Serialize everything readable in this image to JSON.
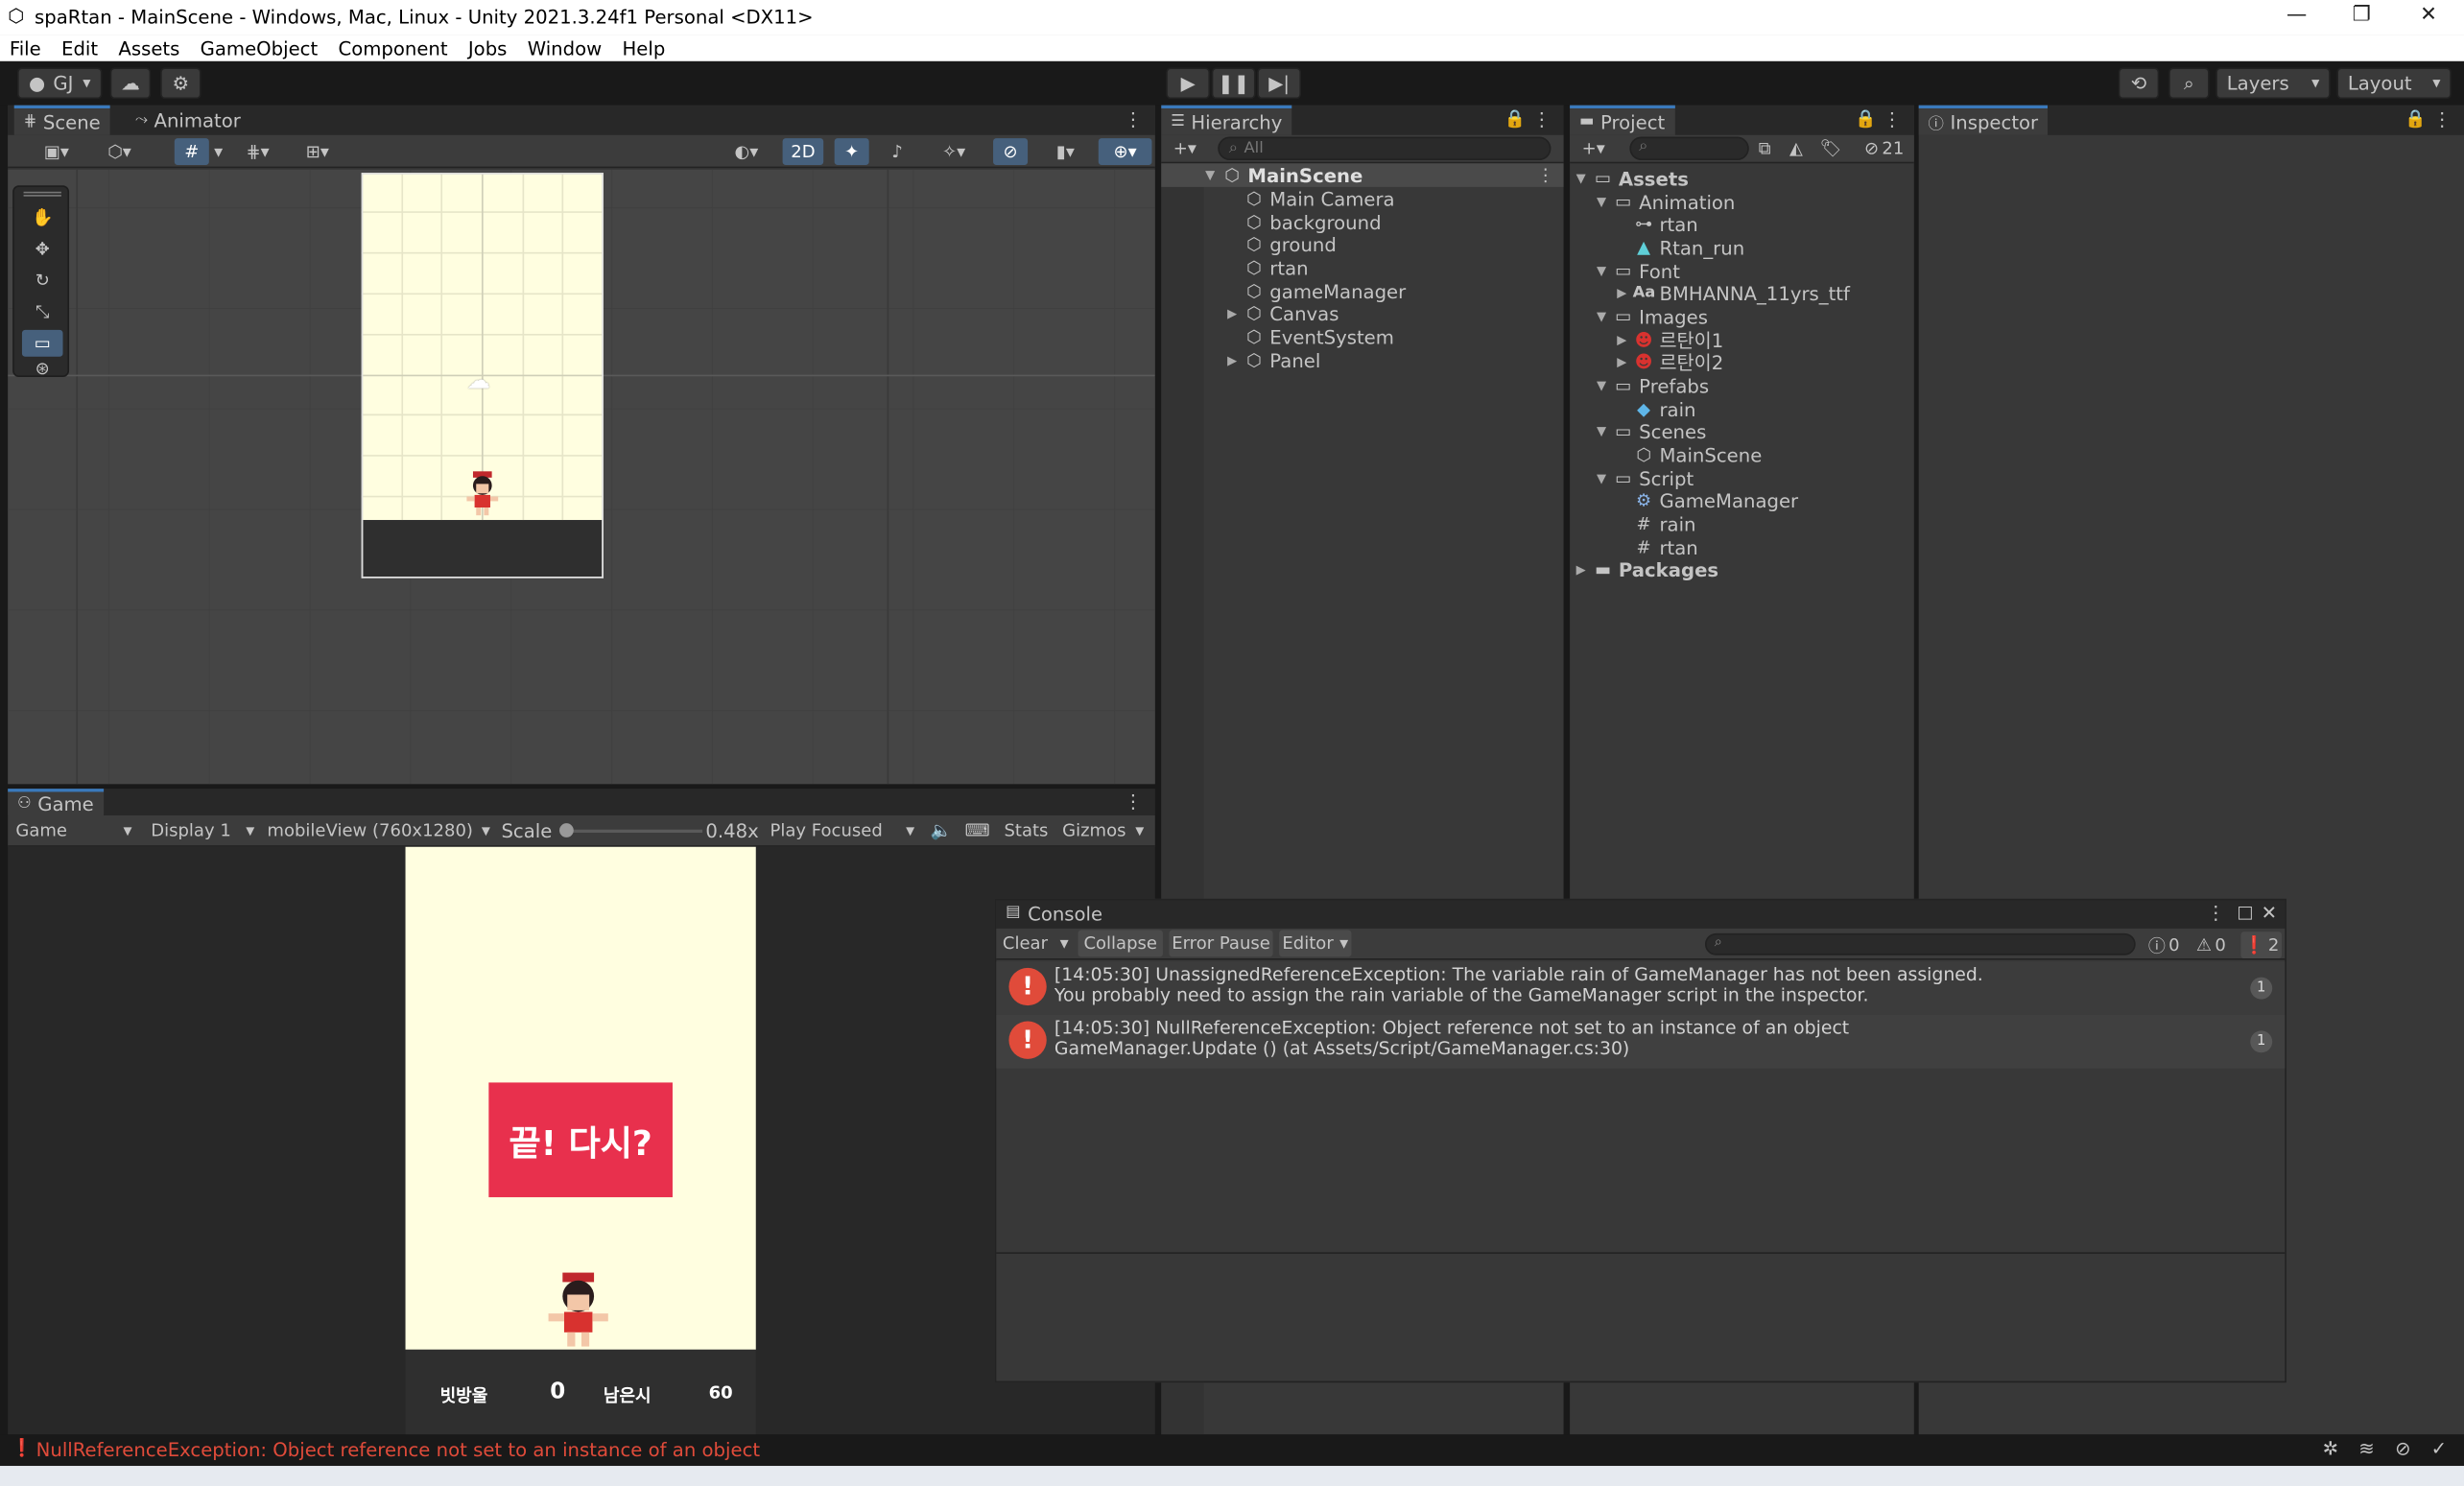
{
  "window": {
    "title": "spaRtan - MainScene - Windows, Mac, Linux - Unity 2021.3.24f1 Personal <DX11>"
  },
  "menu": [
    "File",
    "Edit",
    "Assets",
    "GameObject",
    "Component",
    "Jobs",
    "Window",
    "Help"
  ],
  "toolbar": {
    "account": "GJ",
    "layers": "Layers",
    "layout": "Layout"
  },
  "scene": {
    "tabs": [
      "Scene",
      "Animator"
    ],
    "mode_2d": "2D"
  },
  "game": {
    "tab": "Game",
    "view": "Game",
    "display": "Display 1",
    "resolution": "mobileView (760x1280)",
    "scale_label": "Scale",
    "scale_value": "0.48x",
    "play_mode": "Play Focused",
    "stats": "Stats",
    "gizmos": "Gizmos",
    "scale_fraction": 0.03,
    "button_text": "끝! 다시?",
    "score_label": "빗방울",
    "score_value": "0",
    "time_label": "남은시",
    "time_value": "60"
  },
  "hierarchy": {
    "tab": "Hierarchy",
    "search_placeholder": "All",
    "root": "MainScene",
    "items": [
      "Main Camera",
      "background",
      "ground",
      "rtan",
      "gameManager",
      "Canvas",
      "EventSystem",
      "Panel"
    ]
  },
  "project": {
    "tab": "Project",
    "hidden_count": "21",
    "tree": [
      {
        "label": "Assets",
        "level": 0
      },
      {
        "label": "Animation",
        "level": 1
      },
      {
        "label": "rtan",
        "level": 2
      },
      {
        "label": "Rtan_run",
        "level": 2
      },
      {
        "label": "Font",
        "level": 1
      },
      {
        "label": "BMHANNA_11yrs_ttf",
        "level": 2
      },
      {
        "label": "Images",
        "level": 1
      },
      {
        "label": "르탄이1",
        "level": 2
      },
      {
        "label": "르탄이2",
        "level": 2
      },
      {
        "label": "Prefabs",
        "level": 1
      },
      {
        "label": "rain",
        "level": 2
      },
      {
        "label": "Scenes",
        "level": 1
      },
      {
        "label": "MainScene",
        "level": 2
      },
      {
        "label": "Script",
        "level": 1
      },
      {
        "label": "GameManager",
        "level": 2
      },
      {
        "label": "rain",
        "level": 2
      },
      {
        "label": "rtan",
        "level": 2
      },
      {
        "label": "Packages",
        "level": 0
      }
    ]
  },
  "inspector": {
    "tab": "Inspector"
  },
  "console": {
    "title": "Console",
    "clear": "Clear",
    "collapse": "Collapse",
    "error_pause": "Error Pause",
    "editor": "Editor",
    "log_count": "0",
    "warn_count": "0",
    "error_count": "2",
    "messages": [
      {
        "line1": "[14:05:30] UnassignedReferenceException: The variable rain of GameManager has not been assigned.",
        "line2": "You probably need to assign the rain variable of the GameManager script in the inspector.",
        "count": "1"
      },
      {
        "line1": "[14:05:30] NullReferenceException: Object reference not set to an instance of an object",
        "line2": "GameManager.Update () (at Assets/Script/GameManager.cs:30)",
        "count": "1"
      }
    ]
  },
  "status": {
    "message": "NullReferenceException: Object reference not set to an instance of an object"
  },
  "colors": {
    "accent": "#3a79bb",
    "error": "#e04b3a",
    "game_bg": "#fffee0",
    "button": "#e8304d"
  }
}
